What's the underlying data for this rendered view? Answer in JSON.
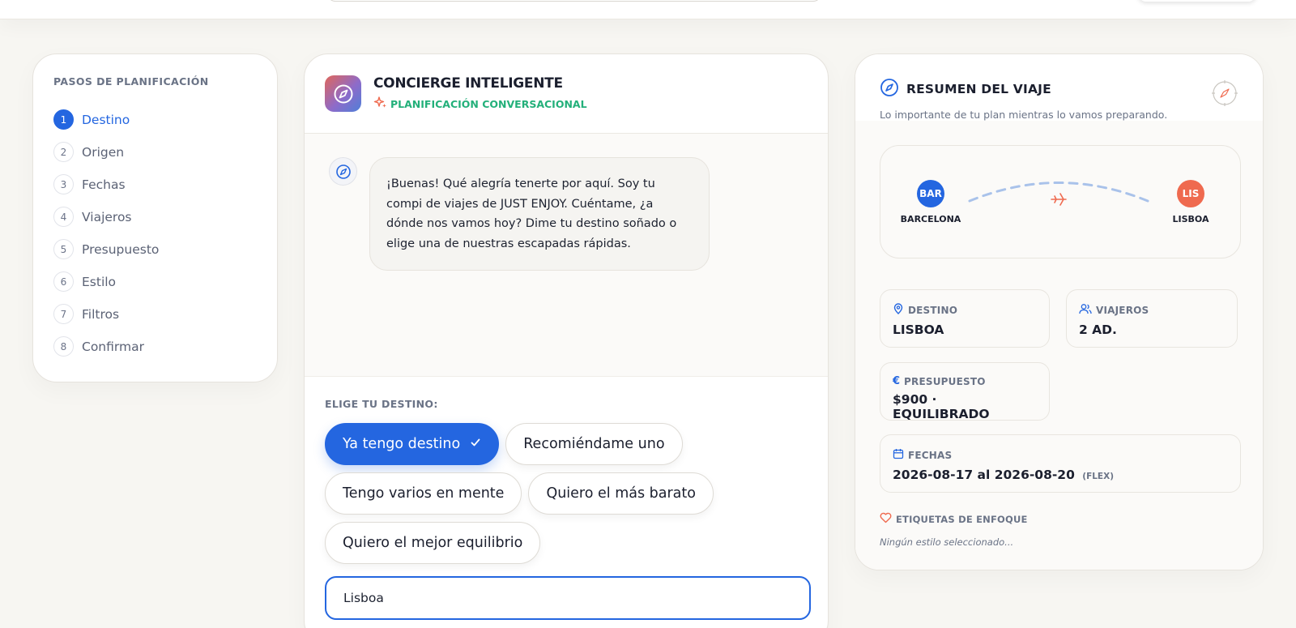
{
  "steps": {
    "title": "PASOS DE PLANIFICACIÓN",
    "items": [
      {
        "num": "1",
        "label": "Destino",
        "active": true
      },
      {
        "num": "2",
        "label": "Origen"
      },
      {
        "num": "3",
        "label": "Fechas"
      },
      {
        "num": "4",
        "label": "Viajeros"
      },
      {
        "num": "5",
        "label": "Presupuesto"
      },
      {
        "num": "6",
        "label": "Estilo"
      },
      {
        "num": "7",
        "label": "Filtros"
      },
      {
        "num": "8",
        "label": "Confirmar"
      }
    ]
  },
  "chat": {
    "title": "CONCIERGE INTELIGENTE",
    "subtitle": "PLANIFICACIÓN CONVERSACIONAL",
    "bot_message": "¡Buenas! Qué alegría tenerte por aquí. Soy tu compi de viajes de JUST ENJOY. Cuéntame, ¿a dónde nos vamos hoy? Dime tu destino soñado o elige una de nuestras escapadas rápidas.",
    "choices_title": "ELIGE TU DESTINO:",
    "choices": {
      "have_destination": "Ya tengo destino",
      "recommend": "Recomiéndame uno",
      "several": "Tengo varios en mente",
      "cheapest": "Quiero el más barato",
      "best_balance": "Quiero el mejor equilibrio"
    },
    "input_value": "Lisboa"
  },
  "summary": {
    "title": "RESUMEN DEL VIAJE",
    "subtitle": "Lo importante de tu plan mientras lo vamos preparando.",
    "origin": {
      "code": "BAR",
      "city": "BARCELONA"
    },
    "destination_airport": {
      "code": "LIS",
      "city": "LISBOA"
    },
    "destino": {
      "label": "DESTINO",
      "value": "LISBOA"
    },
    "viajeros": {
      "label": "VIAJEROS",
      "value": "2 AD."
    },
    "presupuesto": {
      "label": "PRESUPUESTO",
      "value": "$900 · EQUILIBRADO"
    },
    "fechas": {
      "label": "FECHAS",
      "value": "2026-08-17 al 2026-08-20",
      "flex": "(FLEX)"
    },
    "tags": {
      "title": "ETIQUETAS DE ENFOQUE",
      "empty": "Ningún estilo seleccionado..."
    }
  },
  "colors": {
    "accent": "#2466e0",
    "success": "#23b07a",
    "origin_badge": "#2466e0",
    "destination_badge": "#ef6a4f",
    "tag_heart": "#ef6a4f"
  },
  "icons": {
    "logo": "compass-icon",
    "subtitle": "sparkles-icon",
    "chip_check": "check-icon",
    "destino": "map-pin-icon",
    "viajeros": "users-icon",
    "presupuesto": "euro-icon",
    "fechas": "calendar-icon",
    "tags": "heart-icon",
    "route": "plane-icon"
  }
}
